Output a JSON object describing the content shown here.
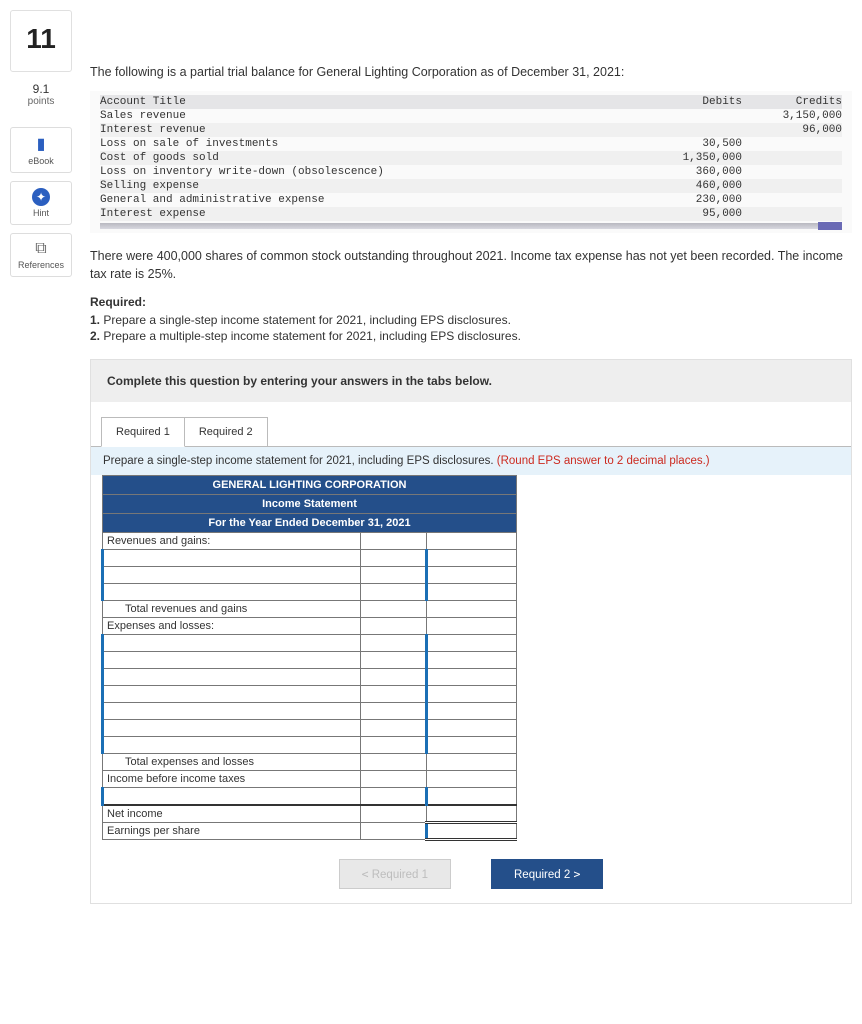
{
  "question_number": "11",
  "points_value": "9.1",
  "points_label": "points",
  "side_buttons": {
    "ebook": "eBook",
    "hint": "Hint",
    "references": "References"
  },
  "intro": "The following is a partial trial balance for General Lighting Corporation as of December 31, 2021:",
  "trial_headers": {
    "title": "Account Title",
    "debits": "Debits",
    "credits": "Credits"
  },
  "trial_rows": [
    {
      "t": "Sales revenue",
      "d": "",
      "c": "3,150,000"
    },
    {
      "t": "Interest revenue",
      "d": "",
      "c": "96,000"
    },
    {
      "t": "Loss on sale of investments",
      "d": "30,500",
      "c": ""
    },
    {
      "t": "Cost of goods sold",
      "d": "1,350,000",
      "c": ""
    },
    {
      "t": "Loss on inventory write-down (obsolescence)",
      "d": "360,000",
      "c": ""
    },
    {
      "t": "Selling expense",
      "d": "460,000",
      "c": ""
    },
    {
      "t": "General and administrative expense",
      "d": "230,000",
      "c": ""
    },
    {
      "t": "Interest expense",
      "d": "95,000",
      "c": ""
    }
  ],
  "body_text": "There were 400,000 shares of common stock outstanding throughout 2021. Income tax expense has not yet been recorded. The income tax rate is 25%.",
  "required_label": "Required:",
  "requirements": [
    "Prepare a single-step income statement for 2021, including EPS disclosures.",
    "Prepare a multiple-step income statement for 2021, including EPS disclosures."
  ],
  "answer_head": "Complete this question by entering your answers in the tabs below.",
  "tabs": {
    "r1": "Required 1",
    "r2": "Required 2"
  },
  "tab_instruction_main": "Prepare a single-step income statement for 2021, including EPS disclosures. ",
  "tab_instruction_note": "(Round EPS answer to 2 decimal places.)",
  "income_header": {
    "company": "GENERAL LIGHTING CORPORATION",
    "title": "Income Statement",
    "period": "For the Year Ended December 31, 2021"
  },
  "income_labels": {
    "rev": "Revenues and gains:",
    "tot_rev": "Total revenues and gains",
    "exp": "Expenses and losses:",
    "tot_exp": "Total expenses and losses",
    "before_tax": "Income before income taxes",
    "net": "Net income",
    "eps": "Earnings per share"
  },
  "nav": {
    "prev": "Required 1",
    "next": "Required 2"
  }
}
